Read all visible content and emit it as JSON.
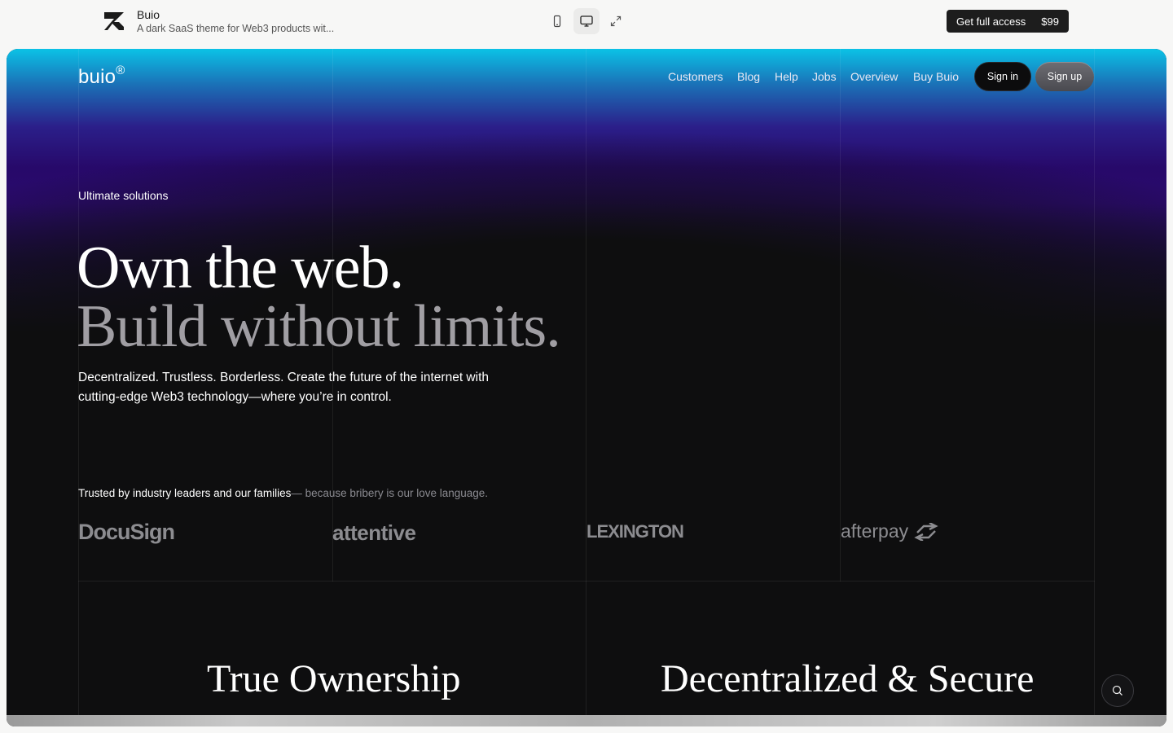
{
  "preview": {
    "name": "Buio",
    "description": "A dark SaaS theme for Web3 products wit...",
    "access_label": "Get full access",
    "access_price": "$99",
    "icons": [
      "brand-logo-icon",
      "mobile-view-icon",
      "desktop-view-icon",
      "expand-icon"
    ]
  },
  "site": {
    "logo": "buio",
    "logo_mark": "®",
    "nav": [
      "Customers",
      "Blog",
      "Help",
      "Jobs",
      "Overview",
      "Buy Buio"
    ],
    "sign_in": "Sign in",
    "sign_up": "Sign up"
  },
  "hero": {
    "eyebrow": "Ultimate solutions",
    "headline_1": "Own the web.",
    "headline_2": "Build without limits.",
    "lede": "Decentralized. Trustless. Borderless. Create the future of the internet with cutting-edge Web3 technology—where you’re in control."
  },
  "trusted": {
    "lead": "Trusted by industry leaders and our families",
    "tail": "— because bribery is our love language.",
    "logos": [
      "DocuSign",
      "attentive",
      "LEXINGTON",
      "afterpay"
    ]
  },
  "features": {
    "left": "True Ownership",
    "right": "Decentralized & Secure"
  },
  "colors": {
    "accent_top": "#0bc2e6",
    "accent_purple": "#27096a",
    "background": "#0e0e0f"
  }
}
